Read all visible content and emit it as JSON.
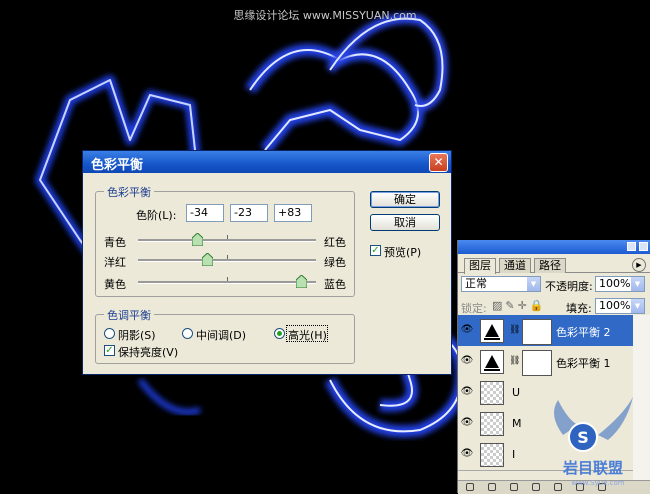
{
  "watermark": "思缘设计论坛 www.MISSYUAN.com",
  "dialog": {
    "title": "色彩平衡",
    "group_balance_label": "色彩平衡",
    "levels_label": "色阶(L):",
    "levels": [
      "-34",
      "-23",
      "+83"
    ],
    "sliders": [
      {
        "left": "青色",
        "right": "红色",
        "value": -34
      },
      {
        "left": "洋红",
        "right": "绿色",
        "value": -23
      },
      {
        "left": "黄色",
        "right": "蓝色",
        "value": 83
      }
    ],
    "group_tone_label": "色调平衡",
    "tone_options": [
      "阴影(S)",
      "中间调(D)",
      "高光(H)"
    ],
    "tone_selected": 2,
    "preserve_label": "保持亮度(V)",
    "preserve_checked": true,
    "ok_label": "确定",
    "cancel_label": "取消",
    "preview_label": "预览(P)",
    "preview_checked": true
  },
  "layers_panel": {
    "tabs": [
      "图层",
      "通道",
      "路径"
    ],
    "active_tab": 0,
    "blend_mode": "正常",
    "opacity_label": "不透明度:",
    "opacity": "100%",
    "lock_label": "锁定:",
    "fill_label": "填充:",
    "fill": "100%",
    "layers": [
      {
        "name": "色彩平衡 2",
        "type": "adjustment",
        "selected": true
      },
      {
        "name": "色彩平衡 1",
        "type": "adjustment",
        "selected": false
      },
      {
        "name": "U",
        "type": "text",
        "selected": false
      },
      {
        "name": "M",
        "type": "text",
        "selected": false
      },
      {
        "name": "I",
        "type": "text",
        "selected": false
      }
    ]
  },
  "brand": {
    "logo_text": "岩目联盟",
    "url_text": "www.Syue.com"
  },
  "colors": {
    "glow": "#2a45e8",
    "title_blue": "#1556c9",
    "selected_row": "#3169c6"
  }
}
